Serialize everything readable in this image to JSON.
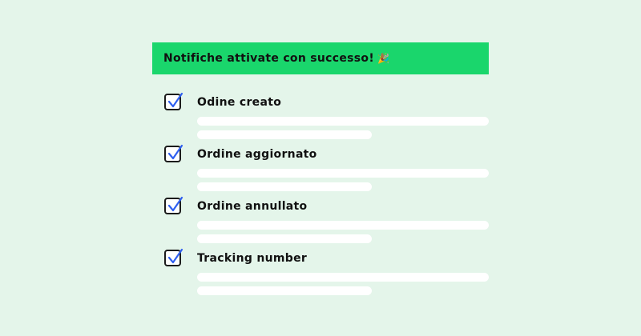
{
  "banner": {
    "text": "Notifiche attivate con successo!",
    "emoji": "🎉"
  },
  "colors": {
    "background": "#e4f5ea",
    "banner": "#1ad66c",
    "check": "#2f5ff0",
    "checkbox_border": "#1b1b1b"
  },
  "notifications": [
    {
      "label": "Odine creato",
      "checked": true
    },
    {
      "label": "Ordine aggiornato",
      "checked": true
    },
    {
      "label": "Ordine annullato",
      "checked": true
    },
    {
      "label": "Tracking number",
      "checked": true
    }
  ]
}
